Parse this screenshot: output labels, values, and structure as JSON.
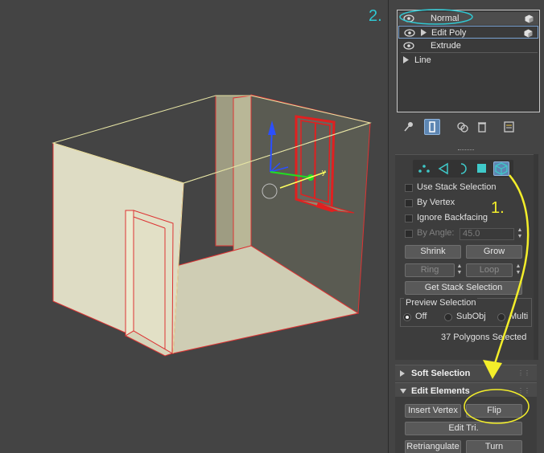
{
  "annotations": {
    "step1": "1.",
    "step2": "2.",
    "color_step1": "#f3ee2a",
    "color_step2": "#30c7d2",
    "arrow_color": "#f3ee2a",
    "highlight_color": "#f3ee2a"
  },
  "stack": {
    "items": [
      {
        "label": "Normal",
        "eye": true,
        "expander": false,
        "cube": true
      },
      {
        "label": "Edit Poly",
        "eye": true,
        "expander": true,
        "cube": true
      },
      {
        "label": "Extrude",
        "eye": true,
        "expander": false,
        "cube": false
      },
      {
        "label": "Line",
        "eye": false,
        "expander": true,
        "cube": false
      }
    ]
  },
  "toolbar": {
    "icons": [
      "pin-stack-icon",
      "show-end-result-icon",
      "make-unique-icon",
      "remove-modifier-icon",
      "configure-modifier-sets-icon"
    ]
  },
  "selection": {
    "modes": [
      "vertex-icon",
      "edge-icon",
      "border-icon",
      "polygon-icon",
      "element-icon"
    ],
    "active_mode": "element-icon",
    "use_stack_selection": "Use Stack Selection",
    "by_vertex": "By Vertex",
    "ignore_backfacing": "Ignore Backfacing",
    "by_angle": "By Angle:",
    "angle_value": "45.0",
    "shrink": "Shrink",
    "grow": "Grow",
    "ring": "Ring",
    "loop": "Loop",
    "get_stack_selection": "Get Stack Selection",
    "preview_selection": "Preview Selection",
    "off": "Off",
    "subobj": "SubObj",
    "multi": "Multi",
    "status": "37 Polygons Selected"
  },
  "soft_selection": {
    "title": "Soft Selection"
  },
  "edit_elements": {
    "title": "Edit Elements",
    "insert_vertex": "Insert Vertex",
    "flip": "Flip",
    "edit_tri": "Edit Tri.",
    "retriangulate": "Retriangulate",
    "turn": "Turn"
  }
}
